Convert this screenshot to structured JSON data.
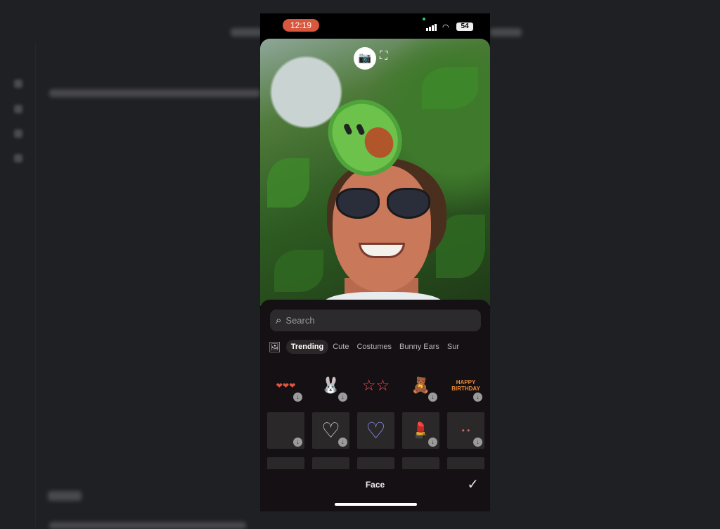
{
  "status_bar": {
    "time": "12:19",
    "battery": "54",
    "time_color": "#d9573c"
  },
  "camera": {
    "capture_icon": "camera-icon",
    "face_icon": "face-scan-icon"
  },
  "sticker_panel": {
    "search_placeholder": "Search",
    "tabs": [
      {
        "label": "Trending",
        "active": true
      },
      {
        "label": "Cute"
      },
      {
        "label": "Costumes"
      },
      {
        "label": "Bunny Ears"
      },
      {
        "label": "Sur"
      }
    ],
    "stickers_row1": [
      {
        "glyph": "❤❤❤"
      },
      {
        "glyph": "🐰"
      },
      {
        "glyph": "☆☆"
      },
      {
        "glyph": "🧸"
      },
      {
        "glyph": "HAPPY BIRTHDAY"
      }
    ],
    "stickers_row2": [
      {
        "glyph": ""
      },
      {
        "glyph": "♡"
      },
      {
        "glyph": "♡"
      },
      {
        "glyph": "💄"
      },
      {
        "glyph": "• •"
      }
    ],
    "mode_label": "Face",
    "confirm_icon": "checkmark-icon"
  }
}
